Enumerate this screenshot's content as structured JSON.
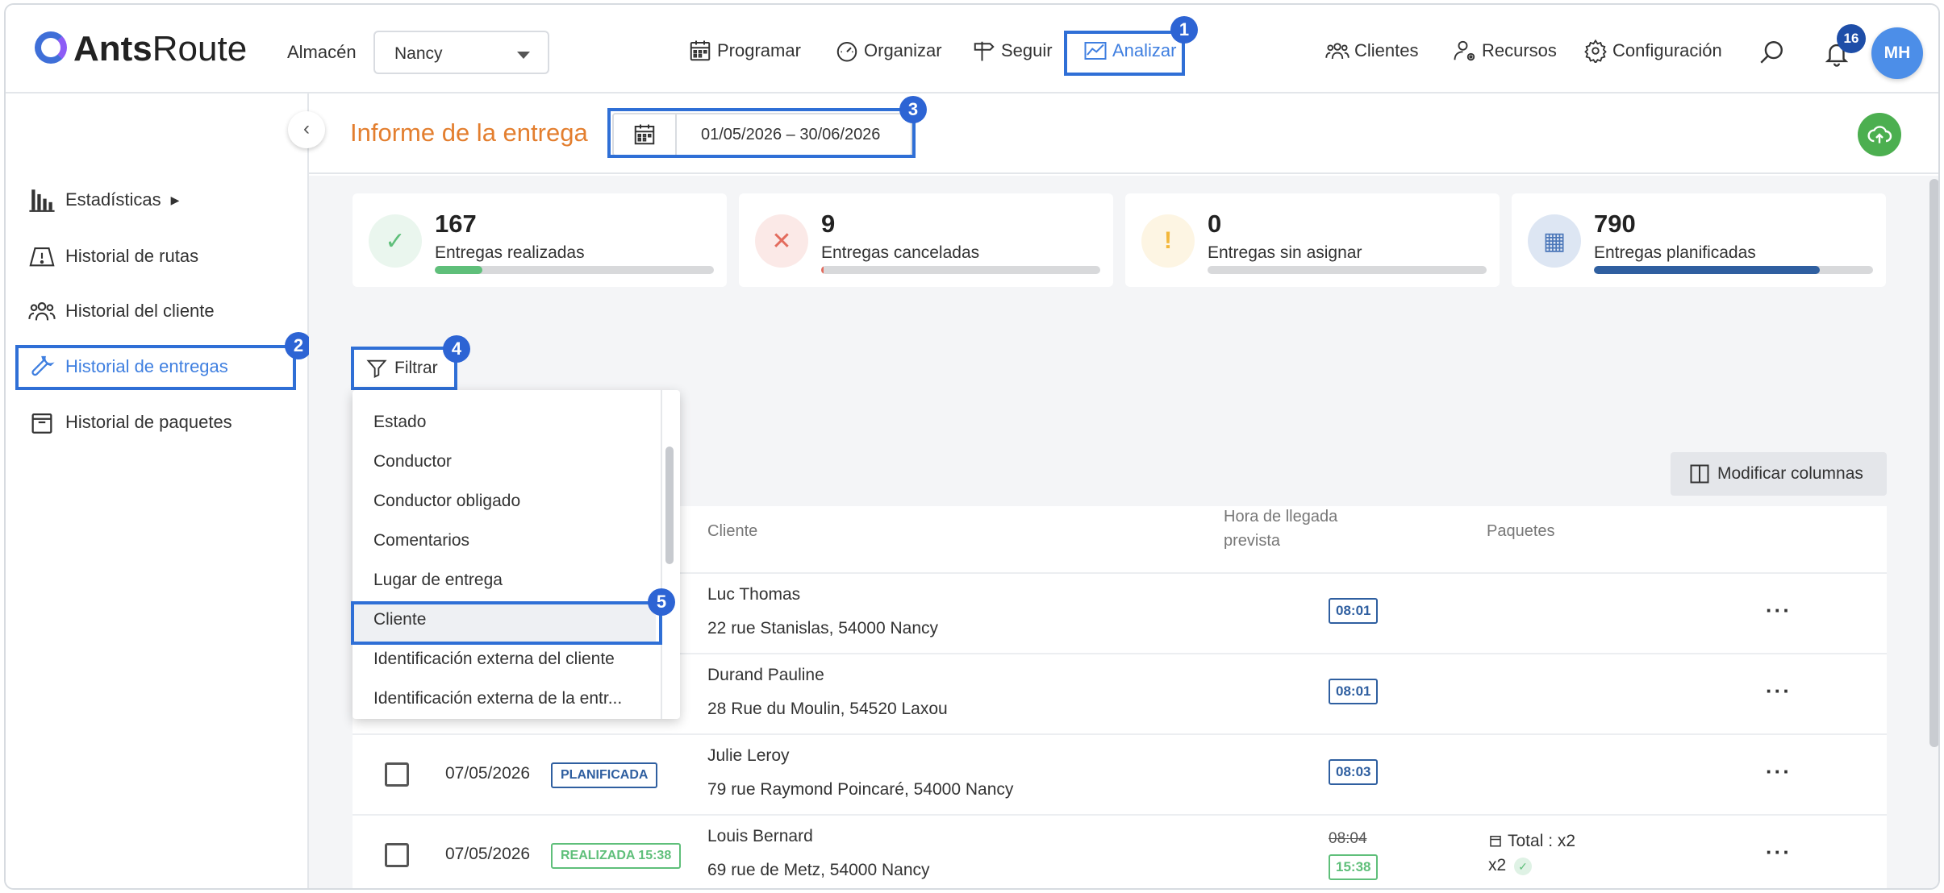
{
  "header": {
    "logo_bold": "Ants",
    "logo_light": "Route",
    "warehouse_label": "Almacén",
    "warehouse_value": "Nancy",
    "nav": [
      {
        "label": "Programar",
        "icon": "calendar-icon"
      },
      {
        "label": "Organizar",
        "icon": "speedometer-icon"
      },
      {
        "label": "Seguir",
        "icon": "signpost-icon"
      },
      {
        "label": "Analizar",
        "icon": "chart-icon",
        "active": true
      }
    ],
    "right_nav": [
      {
        "label": "Clientes",
        "icon": "users-icon"
      },
      {
        "label": "Recursos",
        "icon": "user-gear-icon"
      },
      {
        "label": "Configuración",
        "icon": "gear-icon"
      }
    ],
    "notification_count": "16",
    "avatar_initials": "MH"
  },
  "sidebar": {
    "items": [
      {
        "label": "Estadísticas",
        "suffix": "▶",
        "icon": "bar-chart-icon"
      },
      {
        "label": "Historial de rutas",
        "icon": "map-icon"
      },
      {
        "label": "Historial del cliente",
        "icon": "users-icon"
      },
      {
        "label": "Historial de entregas",
        "icon": "wrench-icon",
        "active": true
      },
      {
        "label": "Historial de paquetes",
        "icon": "package-icon"
      }
    ]
  },
  "page": {
    "title": "Informe de la entrega",
    "date_range": "01/05/2026 – 30/06/2026"
  },
  "stats": [
    {
      "value": "167",
      "label": "Entregas realizadas",
      "progress": 0.17,
      "color": "#5fbf7a",
      "icon_bg": "#eaf6ee",
      "icon_color": "#5fbf7a",
      "icon": "✓"
    },
    {
      "value": "9",
      "label": "Entregas canceladas",
      "progress": 0.01,
      "color": "#e36b5d",
      "icon_bg": "#fbe9e7",
      "icon_color": "#e36b5d",
      "icon": "✕"
    },
    {
      "value": "0",
      "label": "Entregas sin asignar",
      "progress": 0.0,
      "color": "#f3b73b",
      "icon_bg": "#fdf5e3",
      "icon_color": "#f3b73b",
      "icon": "!"
    },
    {
      "value": "790",
      "label": "Entregas planificadas",
      "progress": 0.81,
      "color": "#2f5fa0",
      "icon_bg": "#dde6f3",
      "icon_color": "#4a76b8",
      "icon": "▦"
    }
  ],
  "toolbar": {
    "filter_label": "Filtrar",
    "modify_columns_label": "Modificar columnas"
  },
  "filter_menu": {
    "items": [
      "Estado",
      "Conductor",
      "Conductor obligado",
      "Comentarios",
      "Lugar de entrega",
      "Cliente",
      "Identificación externa del cliente",
      "Identificación externa de la entr..."
    ],
    "selected": "Cliente"
  },
  "table": {
    "headers": {
      "client": "Cliente",
      "arrival_1": "Hora de llegada",
      "arrival_2": "prevista",
      "packages": "Paquetes"
    },
    "rows": [
      {
        "date": "",
        "status": "",
        "name": "Luc Thomas",
        "address": "22 rue Stanislas, 54000 Nancy",
        "time": "08:01",
        "time_old": "",
        "packages_total": "",
        "packages_count": ""
      },
      {
        "date": "",
        "status": "",
        "name": "Durand Pauline",
        "address": "28 Rue du Moulin, 54520 Laxou",
        "time": "08:01",
        "time_old": "",
        "packages_total": "",
        "packages_count": ""
      },
      {
        "date": "07/05/2026",
        "status": "PLANIFICADA",
        "name": "Julie Leroy",
        "address": "79 rue Raymond Poincaré, 54000 Nancy",
        "time": "08:03",
        "time_old": "",
        "packages_total": "",
        "packages_count": ""
      },
      {
        "date": "07/05/2026",
        "status": "REALIZADA 15:38",
        "name": "Louis Bernard",
        "address": "69 rue de Metz, 54000 Nancy",
        "time": "15:38",
        "time_old": "08:04",
        "packages_total": "Total : x2",
        "packages_count": "x2"
      }
    ]
  },
  "annotations": [
    "1",
    "2",
    "3",
    "4",
    "5"
  ],
  "colors": {
    "accent": "#2f6fd6",
    "title": "#e37e2e",
    "planned": "#2f5fa0",
    "done": "#5fbf7a"
  }
}
